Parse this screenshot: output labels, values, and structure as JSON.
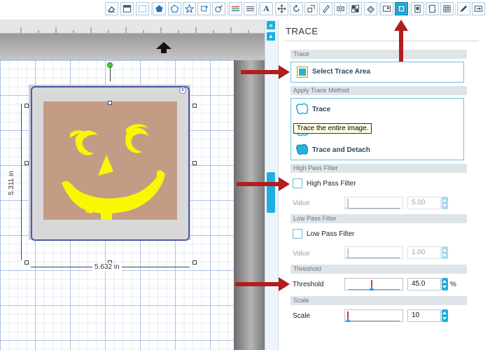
{
  "panel": {
    "title": "TRACE",
    "sections": {
      "trace": {
        "header": "Trace",
        "select_label": "Select Trace Area"
      },
      "apply": {
        "header": "Apply Trace Method",
        "trace_label": "Trace",
        "detach_label": "Trace and Detach",
        "tooltip": "Trace the entire image."
      },
      "high_pass": {
        "header": "High Pass Filter",
        "checkbox_label": "High Pass Filter",
        "checked": false,
        "value_label": "Value",
        "value": "5.00",
        "slider_level_pct": 0
      },
      "low_pass": {
        "header": "Low Pass Filter",
        "checkbox_label": "Low Pass Filter",
        "checked": false,
        "value_label": "Value",
        "value": "1.00",
        "slider_level_pct": 0
      },
      "threshold": {
        "header": "Threshold",
        "label": "Threshold",
        "value": "45.0",
        "unit": "%",
        "slider_level_pct": 45
      },
      "scale": {
        "header": "Scale",
        "label": "Scale",
        "value": "10",
        "slider_level_pct": 0
      }
    }
  },
  "canvas": {
    "width_label": "5.632 in",
    "height_label": "5.311 in"
  },
  "toolbar": {
    "icons": [
      "eraser-icon",
      "window-icon",
      "dotted-rect-icon",
      "pentagon-fill-icon",
      "pentagon-icon",
      "star-icon",
      "shape-edit-icon",
      "knife-icon",
      "align-icon",
      "lines-icon",
      "text-icon",
      "move-icon",
      "rotate-icon",
      "scale-icon",
      "pen-icon",
      "mirror-icon",
      "replicate-icon",
      "fill-icon",
      "trace-icon",
      "page-icon",
      "cut-window-icon",
      "grid-icon",
      "pencil-icon",
      "send-icon"
    ]
  },
  "colors": {
    "accent": "#1eaee2",
    "annotation": "#b21d1d",
    "face": "#f8f800",
    "photo": "#c49c86",
    "mat_border": "#4f58a8"
  }
}
